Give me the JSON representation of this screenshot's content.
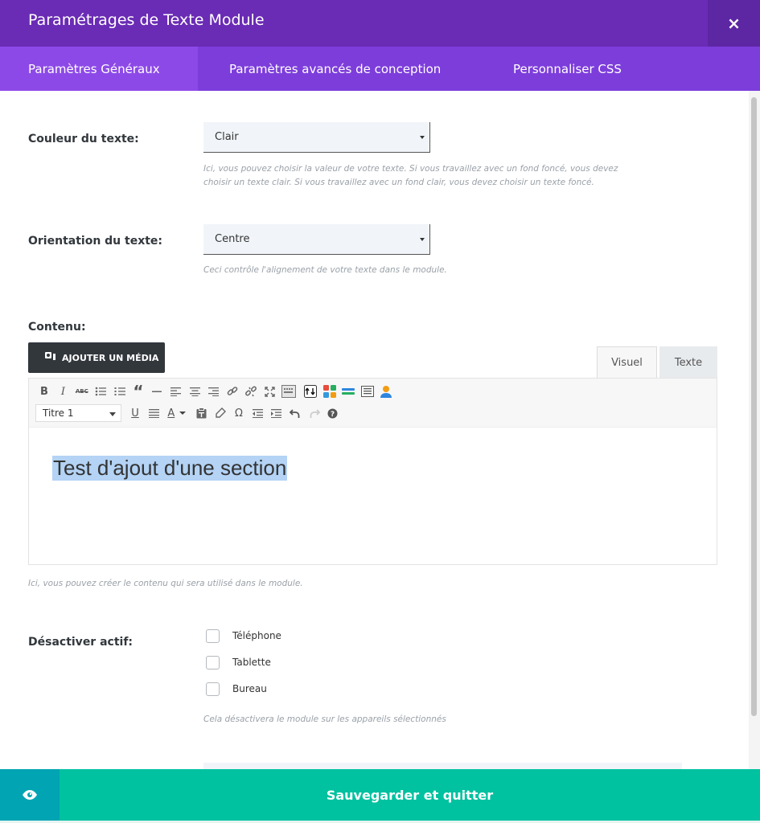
{
  "header": {
    "title": "Paramétrages de Texte Module",
    "close_glyph": "×"
  },
  "tabs": [
    {
      "label": "Paramètres Généraux",
      "active": true
    },
    {
      "label": "Paramètres avancés de conception",
      "active": false
    },
    {
      "label": "Personnaliser CSS",
      "active": false
    }
  ],
  "fields": {
    "text_color": {
      "label": "Couleur du texte:",
      "value": "Clair",
      "description_line1": "Ici, vous pouvez choisir la valeur de votre texte. Si vous travaillez avec un fond foncé, vous devez",
      "description_line2": "choisir un texte clair. Si vous travaillez avec un fond clair, vous devez choisir un texte foncé."
    },
    "text_orientation": {
      "label": "Orientation du texte:",
      "value": "Centre",
      "description": "Ceci contrôle l'alignement de votre texte dans le module."
    },
    "content": {
      "label": "Contenu:",
      "add_media_label": "AJOUTER UN MÉDIA",
      "tab_visual": "Visuel",
      "tab_text": "Texte",
      "format_value": "Titre 1",
      "editor_text": "Test d'ajout d'une section",
      "description": "Ici, vous pouvez créer le contenu qui sera utilisé dans le module."
    },
    "disable": {
      "label": "Désactiver actif:",
      "options": [
        "Téléphone",
        "Tablette",
        "Bureau"
      ],
      "description": "Cela désactivera le module sur les appareils sélectionnés"
    }
  },
  "toolbar": {
    "row1": [
      "bold-icon",
      "italic-icon",
      "strikethrough-icon",
      "bullet-list-icon",
      "numbered-list-icon",
      "blockquote-icon",
      "horizontal-rule-icon",
      "align-left-icon",
      "align-center-icon",
      "align-right-icon",
      "link-icon",
      "unlink-icon",
      "fullscreen-icon",
      "toolbar-toggle-icon",
      "shortcode-icon",
      "layout-icon",
      "divider-icon",
      "table-icon",
      "user-icon"
    ],
    "row2": [
      "underline-icon",
      "justify-icon",
      "text-color-icon",
      "paste-text-icon",
      "clear-format-icon",
      "special-char-icon",
      "outdent-icon",
      "indent-icon",
      "undo-icon",
      "redo-icon",
      "help-icon"
    ],
    "labels": {
      "bold": "B",
      "italic": "I",
      "strike": "ABC",
      "quote": "“",
      "underline": "U",
      "text_color": "A",
      "omega": "Ω"
    }
  },
  "footer": {
    "save_label": "Sauvegarder et quitter"
  },
  "colors": {
    "header": "#6a2bb5",
    "tabs": "#7d3ddb",
    "active_tab": "#8d49e8",
    "save": "#00c1a0",
    "preview": "#00a4b3"
  }
}
